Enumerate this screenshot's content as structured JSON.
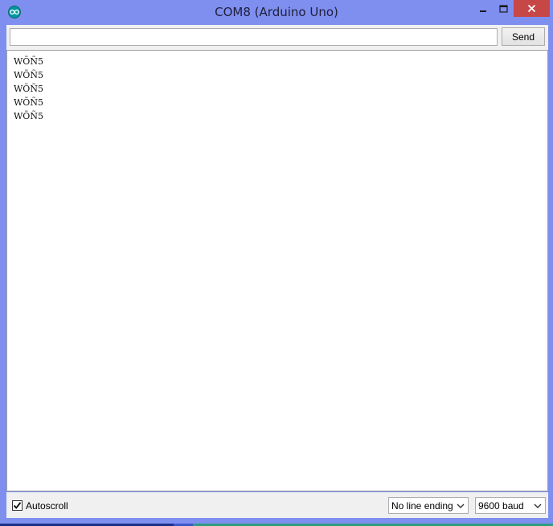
{
  "window": {
    "title": "COM8 (Arduino Uno)",
    "app_icon": "arduino-icon",
    "controls": [
      "minimize-icon",
      "maximize-icon",
      "close-icon"
    ],
    "close_color": "#c74646",
    "frame_color": "#7e8ff0"
  },
  "input": {
    "value": "",
    "send_label": "Send"
  },
  "output": {
    "lines": [
      "WÕÑ5",
      "WÕÑ5",
      "WÕÑ5",
      "WÕÑ5",
      "WÕÑ5"
    ]
  },
  "status": {
    "autoscroll_label": "Autoscroll",
    "autoscroll_checked": true,
    "line_ending": "No line ending",
    "baud_rate": "9600 baud"
  }
}
